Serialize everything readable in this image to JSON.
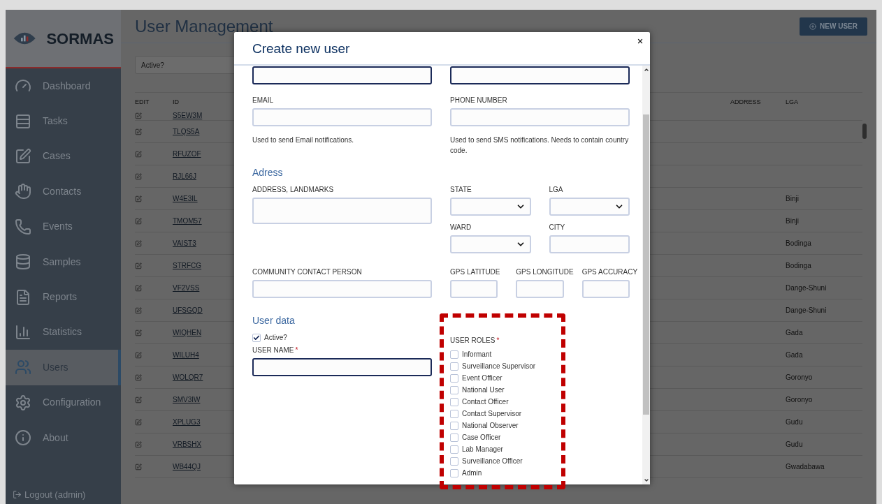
{
  "app": {
    "logo": "SORMAS"
  },
  "sidebar": {
    "items": [
      {
        "label": "Dashboard",
        "selected": false
      },
      {
        "label": "Tasks",
        "selected": false
      },
      {
        "label": "Cases",
        "selected": false
      },
      {
        "label": "Contacts",
        "selected": false
      },
      {
        "label": "Events",
        "selected": false
      },
      {
        "label": "Samples",
        "selected": false
      },
      {
        "label": "Reports",
        "selected": false
      },
      {
        "label": "Statistics",
        "selected": false
      },
      {
        "label": "Users",
        "selected": true
      },
      {
        "label": "Configuration",
        "selected": false
      },
      {
        "label": "About",
        "selected": false
      }
    ],
    "logout": "Logout (admin)"
  },
  "page": {
    "title": "User Management",
    "new_button": "NEW USER",
    "filter": {
      "placeholder": "Active?"
    }
  },
  "table": {
    "columns": [
      "EDIT",
      "ID",
      "ADDRESS",
      "LGA"
    ],
    "rows": [
      {
        "id": "S5EW3M"
      },
      {
        "id": "TLQS5A"
      },
      {
        "id": "RFUZOF"
      },
      {
        "id": "RJL66J"
      },
      {
        "id": "W4E3IL",
        "lga": "Binji"
      },
      {
        "id": "TMOM57",
        "lga": "Binji"
      },
      {
        "id": "VAIST3",
        "lga": "Bodinga"
      },
      {
        "id": "STRFCG",
        "lga": "Bodinga"
      },
      {
        "id": "VF2VSS",
        "lga": "Dange-Shuni"
      },
      {
        "id": "UFSGQD",
        "lga": "Dange-Shuni"
      },
      {
        "id": "WIQHEN",
        "lga": "Gada"
      },
      {
        "id": "WILUH4",
        "lga": "Gada"
      },
      {
        "id": "WOLQR7",
        "lga": "Goronyo"
      },
      {
        "id": "SMV3IW",
        "lga": "Goronyo"
      },
      {
        "id": "XPLUG3",
        "lga": "Gudu"
      },
      {
        "id": "VRBSHX",
        "lga": "Gudu"
      },
      {
        "id": "WB44QJ",
        "lga": "Gwadabawa"
      }
    ]
  },
  "dialog": {
    "title": "Create new user",
    "required_mark": "*",
    "top_fields": [
      {
        "required": true
      },
      {
        "required": true
      }
    ],
    "email": {
      "label": "EMAIL",
      "hint": "Used to send Email notifications.",
      "required": false
    },
    "phone": {
      "label": "PHONE NUMBER",
      "hint": "Used to send SMS notifications. Needs to contain country code.",
      "required": false
    },
    "address_section": {
      "title": "Adress",
      "address": {
        "label": "ADDRESS, LANDMARKS"
      },
      "state": {
        "label": "STATE"
      },
      "lga": {
        "label": "LGA"
      },
      "ward": {
        "label": "WARD"
      },
      "city": {
        "label": "CITY"
      },
      "community_contact": {
        "label": "COMMUNITY CONTACT PERSON"
      },
      "gps": [
        {
          "label": "GPS LATITUDE"
        },
        {
          "label": "GPS LONGITUDE"
        },
        {
          "label": "GPS ACCURACY"
        }
      ]
    },
    "user_section": {
      "title": "User data",
      "active": {
        "label": "Active?",
        "checked": true
      },
      "user_name": {
        "label": "USER NAME",
        "required": true
      },
      "roles": {
        "label": "USER ROLES",
        "required": true,
        "items": [
          {
            "label": "Informant",
            "checked": false
          },
          {
            "label": "Surveillance Supervisor",
            "checked": false
          },
          {
            "label": "Event Officer",
            "checked": false
          },
          {
            "label": "National User",
            "checked": false
          },
          {
            "label": "Contact Officer",
            "checked": false
          },
          {
            "label": "Contact Supervisor",
            "checked": false
          },
          {
            "label": "National Observer",
            "checked": false
          },
          {
            "label": "Case Officer",
            "checked": false
          },
          {
            "label": "Lab Manager",
            "checked": false
          },
          {
            "label": "Surveillance Officer",
            "checked": false
          },
          {
            "label": "Admin",
            "checked": false
          }
        ]
      }
    }
  }
}
